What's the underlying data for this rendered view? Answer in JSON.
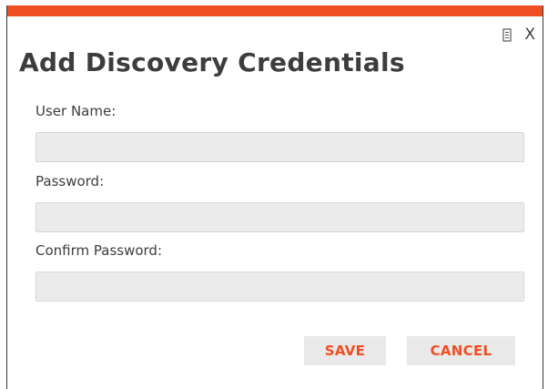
{
  "dialog": {
    "title": "Add Discovery Credentials",
    "accent_color": "#f04e23",
    "close_label": "X",
    "icons": {
      "help": "document-icon",
      "close": "close-icon"
    }
  },
  "form": {
    "username": {
      "label": "User Name:",
      "value": "",
      "placeholder": ""
    },
    "password": {
      "label": "Password:",
      "value": "",
      "placeholder": ""
    },
    "confirm_password": {
      "label": "Confirm Password:",
      "value": "",
      "placeholder": ""
    }
  },
  "actions": {
    "save_label": "SAVE",
    "cancel_label": "CANCEL"
  }
}
